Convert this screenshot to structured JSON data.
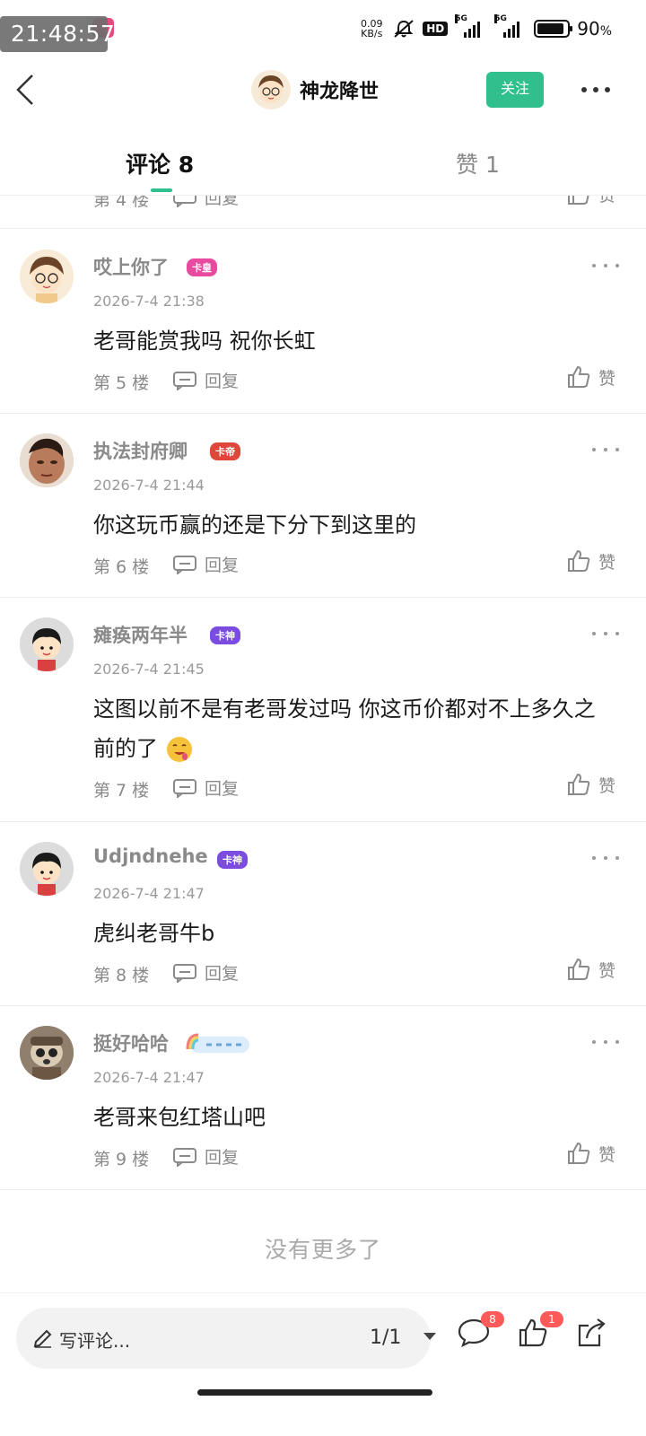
{
  "status_bar": {
    "time": "21:48:57",
    "net_speed_value": "0.09",
    "net_speed_unit": "KB/s",
    "hd_label": "HD",
    "signal_1_label": "5G",
    "signal_2_label": "5G",
    "battery_percent": "90",
    "battery_percent_sign": "%",
    "battery_level": 0.9
  },
  "header": {
    "author_name": "神龙降世",
    "follow_label": "关注"
  },
  "tabs": {
    "comments_label": "评论 8",
    "likes_label": "赞 1"
  },
  "partial_row": {
    "floor": "第 4 楼",
    "reply_label": "回复",
    "like_label": "赞"
  },
  "comments": [
    {
      "name": "哎上你了",
      "badge": "卡皇",
      "badge_color": "#e84aa0",
      "time": "2026-7-4 21:38",
      "text": "老哥能赏我吗 祝你长虹",
      "floor": "第 5 楼",
      "reply_label": "回复",
      "like_label": "赞"
    },
    {
      "name": "执法封府卿",
      "badge": "卡帝",
      "badge_color": "#e0463a",
      "time": "2026-7-4 21:44",
      "text": "你这玩币赢的还是下分下到这里的",
      "floor": "第 6 楼",
      "reply_label": "回复",
      "like_label": "赞"
    },
    {
      "name": "瘫痪两年半",
      "badge": "卡神",
      "badge_color": "#7a4ce0",
      "time": "2026-7-4 21:45",
      "text": "这图以前不是有老哥发过吗 你这币价都对不上多久之前的了",
      "floor": "第 7 楼",
      "reply_label": "回复",
      "like_label": "赞"
    },
    {
      "name": "Udjndnehe",
      "badge": "卡神",
      "badge_color": "#7a4ce0",
      "time": "2026-7-4 21:47",
      "text": "虎纠老哥牛b",
      "floor": "第 8 楼",
      "reply_label": "回复",
      "like_label": "赞"
    },
    {
      "name": "挺好哈哈",
      "badge": "",
      "badge_color": "#3aa7e6",
      "time": "2026-7-4 21:47",
      "text": "老哥来包红塔山吧",
      "floor": "第 9 楼",
      "reply_label": "回复",
      "like_label": "赞"
    }
  ],
  "footer_note": "没有更多了",
  "bottom_bar": {
    "input_placeholder": "写评论...",
    "page_indicator": "1/1",
    "comment_count": "8",
    "like_count": "1"
  }
}
